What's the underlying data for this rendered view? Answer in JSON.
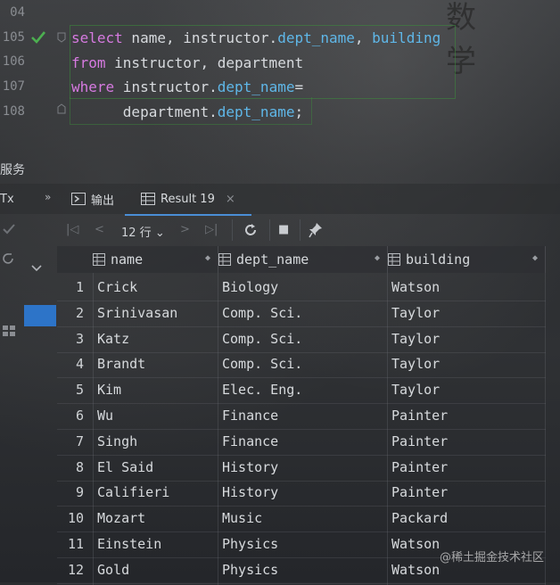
{
  "editor": {
    "line_numbers": [
      "04",
      "105",
      "106",
      "107",
      "108"
    ],
    "deco_chars": "数 学",
    "lines": [
      [
        {
          "t": "select",
          "c": "kw"
        },
        {
          "t": " name, instructor.",
          "c": ""
        },
        {
          "t": "dept_name",
          "c": "fld"
        },
        {
          "t": ", ",
          "c": ""
        },
        {
          "t": "building",
          "c": "fld"
        }
      ],
      [
        {
          "t": "from",
          "c": "kw"
        },
        {
          "t": " instructor, department",
          "c": ""
        }
      ],
      [
        {
          "t": "where",
          "c": "kw"
        },
        {
          "t": " instructor.",
          "c": ""
        },
        {
          "t": "dept_name",
          "c": "fld"
        },
        {
          "t": "=",
          "c": ""
        }
      ],
      [
        {
          "t": "      department.",
          "c": ""
        },
        {
          "t": "dept_name",
          "c": "fld"
        },
        {
          "t": ";",
          "c": ""
        }
      ]
    ]
  },
  "services": {
    "title": "服务",
    "tx_label": "Tx"
  },
  "tabs": [
    {
      "label": "输出",
      "icon": "console-icon"
    },
    {
      "label": "Result 19",
      "icon": "table-icon",
      "active": true,
      "close": "×"
    }
  ],
  "toolbar": {
    "rows_label": "12 行",
    "rows_dropdown": "⌄"
  },
  "table": {
    "columns": [
      "name",
      "dept_name",
      "building"
    ],
    "rows": [
      [
        "1",
        "Crick",
        "Biology",
        "Watson"
      ],
      [
        "2",
        "Srinivasan",
        "Comp. Sci.",
        "Taylor"
      ],
      [
        "3",
        "Katz",
        "Comp. Sci.",
        "Taylor"
      ],
      [
        "4",
        "Brandt",
        "Comp. Sci.",
        "Taylor"
      ],
      [
        "5",
        "Kim",
        "Elec. Eng.",
        "Taylor"
      ],
      [
        "6",
        "Wu",
        "Finance",
        "Painter"
      ],
      [
        "7",
        "Singh",
        "Finance",
        "Painter"
      ],
      [
        "8",
        "El Said",
        "History",
        "Painter"
      ],
      [
        "9",
        "Califieri",
        "History",
        "Painter"
      ],
      [
        "10",
        "Mozart",
        "Music",
        "Packard"
      ],
      [
        "11",
        "Einstein",
        "Physics",
        "Watson"
      ],
      [
        "12",
        "Gold",
        "Physics",
        "Watson"
      ]
    ]
  },
  "watermark": "@稀土掘金技术社区",
  "colors": {
    "keyword": "#d67ae0",
    "field": "#5fb7e8",
    "accent": "#2d74c8",
    "check": "#4caf50"
  }
}
